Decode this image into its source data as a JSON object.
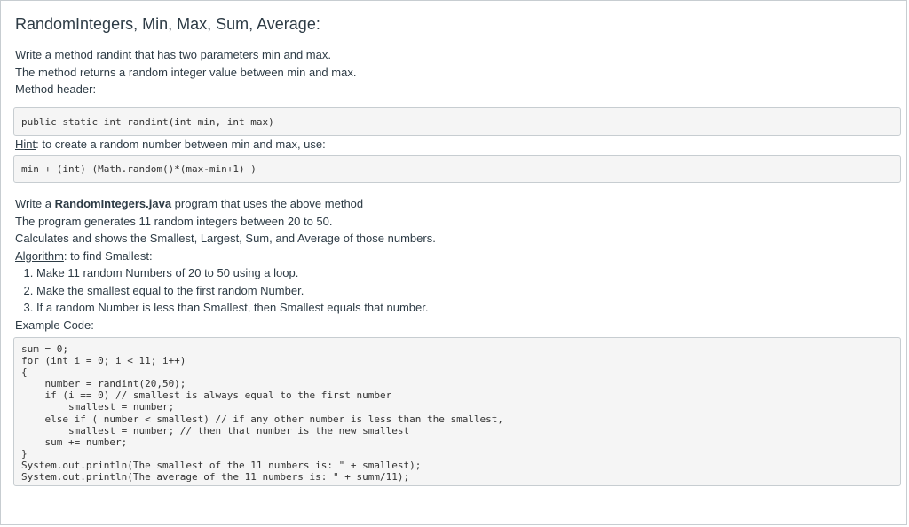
{
  "title": "RandomIntegers, Min, Max, Sum, Average:",
  "intro": [
    "Write a method randint that has two parameters min and max.",
    "The method returns a random integer value between min and max.",
    "Method header:"
  ],
  "method_header_code": "public static int randint(int min, int max)",
  "hint": {
    "label": "Hint",
    "text": ": to create a random number between min and max, use:"
  },
  "hint_code": "min + (int) (Math.random()*(max-min+1) )",
  "program": {
    "prefix": "Write a ",
    "filename": "RandomIntegers.java",
    "suffix": " program that uses the above method",
    "lines": [
      "The program generates 11 random integers between 20 to 50.",
      "Calculates and shows the Smallest, Largest, Sum, and Average of those numbers."
    ]
  },
  "algorithm": {
    "label": "Algorithm",
    "text": ": to find Smallest:",
    "steps": [
      "Make 11 random Numbers of 20 to 50 using a loop.",
      "Make the smallest equal to the first random Number.",
      "If a random Number is less than Smallest, then Smallest equals that number."
    ]
  },
  "example_label": "Example Code:",
  "example_code": "sum = 0;\nfor (int i = 0; i < 11; i++)\n{\n    number = randint(20,50);\n    if (i == 0) // smallest is always equal to the first number\n        smallest = number;\n    else if ( number < smallest) // if any other number is less than the smallest,\n        smallest = number; // then that number is the new smallest\n    sum += number;\n}\nSystem.out.println(The smallest of the 11 numbers is: \" + smallest);\nSystem.out.println(The average of the 11 numbers is: \" + summ/11);"
}
